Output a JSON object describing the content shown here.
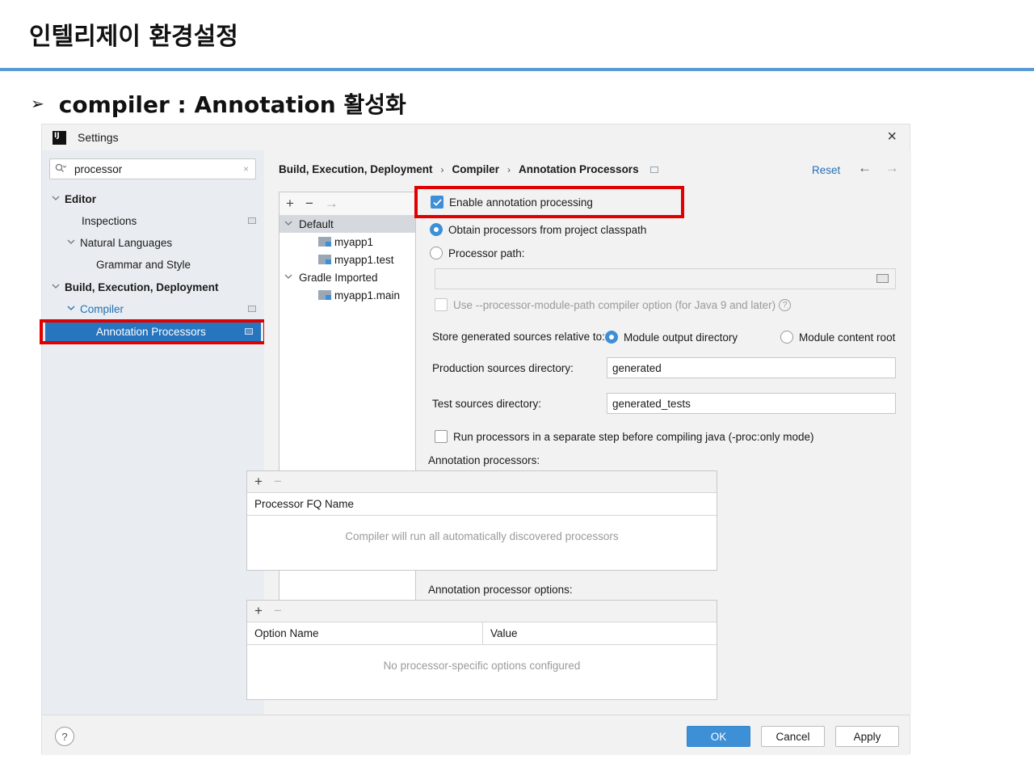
{
  "slide": {
    "title": "인텔리제이 환경설정",
    "bullet_arrow": "➢",
    "bullet_text": "compiler : Annotation 활성화"
  },
  "dialog": {
    "logo_text": "IJ",
    "title": "Settings",
    "close": "×"
  },
  "search": {
    "icon": "search-icon",
    "value": "processor",
    "clear": "×"
  },
  "sidebar": {
    "items": [
      {
        "label": "Editor"
      },
      {
        "label": "Inspections"
      },
      {
        "label": "Natural Languages"
      },
      {
        "label": "Grammar and Style"
      },
      {
        "label": "Build, Execution, Deployment"
      },
      {
        "label": "Compiler"
      },
      {
        "label": "Annotation Processors"
      }
    ]
  },
  "breadcrumb": {
    "items": [
      "Build, Execution, Deployment",
      "Compiler",
      "Annotation Processors"
    ],
    "sep": "›"
  },
  "header": {
    "reset": "Reset",
    "back": "←",
    "forward": "→"
  },
  "profiles": {
    "add": "+",
    "remove": "−",
    "move": "→",
    "items": [
      "Default",
      "myapp1",
      "myapp1.test",
      "Gradle Imported",
      "myapp1.main"
    ]
  },
  "options": {
    "enable_annotation": "Enable annotation processing",
    "obtain_classpath": "Obtain processors from project classpath",
    "processor_path": "Processor path:",
    "processor_path_value": "",
    "module_path_option": "Use --processor-module-path compiler option (for Java 9 and later)",
    "store_relative_label": "Store generated sources relative to:",
    "module_output": "Module output directory",
    "module_content": "Module content root",
    "production_label": "Production sources directory:",
    "production_value": "generated",
    "test_label": "Test sources directory:",
    "test_value": "generated_tests",
    "run_separate": "Run processors in a separate step before compiling java (-proc:only mode)",
    "help": "?"
  },
  "processors_table": {
    "label": "Annotation processors:",
    "add": "+",
    "remove": "−",
    "column": "Processor FQ Name",
    "empty": "Compiler will run all automatically discovered processors"
  },
  "options_table": {
    "label": "Annotation processor options:",
    "add": "+",
    "remove": "−",
    "col_name": "Option Name",
    "col_value": "Value",
    "empty": "No processor-specific options configured"
  },
  "footer": {
    "help": "?",
    "ok": "OK",
    "cancel": "Cancel",
    "apply": "Apply"
  },
  "colors": {
    "accent": "#3d8fd6",
    "selection": "#2675bf",
    "highlight": "#e00000",
    "slide_rule": "#5b9bd5"
  }
}
